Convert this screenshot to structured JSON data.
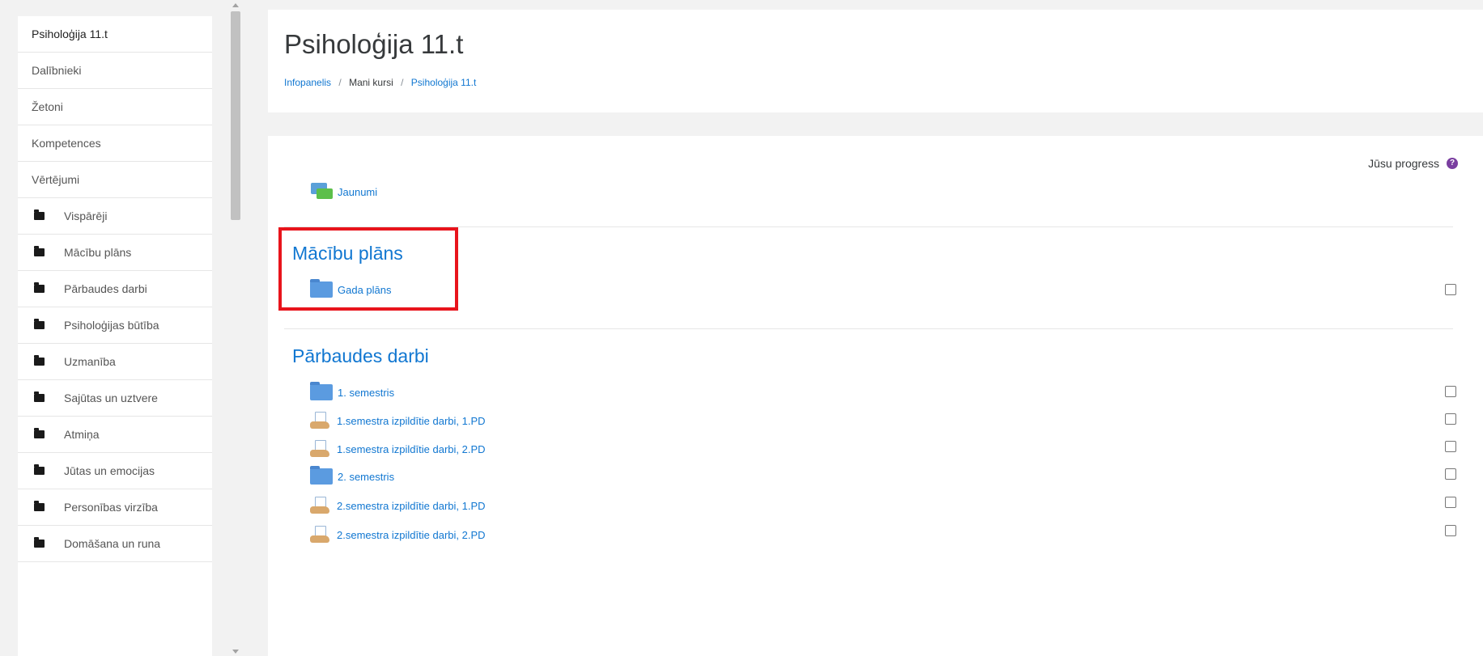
{
  "sidebar": {
    "course": "Psiholoģija 11.t",
    "nav": [
      "Dalībnieki",
      "Žetoni",
      "Kompetences",
      "Vērtējumi"
    ],
    "sections": [
      "Vispārēji",
      "Mācību plāns",
      "Pārbaudes darbi",
      "Psiholoģijas būtība",
      "Uzmanība",
      "Sajūtas un uztvere",
      "Atmiņa",
      "Jūtas un emocijas",
      "Personības virzība",
      "Domāšana un runa"
    ]
  },
  "header": {
    "title": "Psiholoģija 11.t",
    "breadcrumb": [
      "Infopanelis",
      "Mani kursi",
      "Psiholoģija 11.t"
    ]
  },
  "content": {
    "progress_label": "Jūsu progress",
    "help_icon": "?",
    "news": "Jaunumi",
    "sections": [
      {
        "title": "Mācību plāns",
        "activities": [
          "Gada plāns"
        ]
      },
      {
        "title": "Pārbaudes darbi",
        "activities": [
          "1. semestris",
          "1.semestra izpildītie darbi, 1.PD",
          "1.semestra izpildītie darbi, 2.PD",
          "2. semestris",
          "2.semestra izpildītie darbi, 1.PD",
          "2.semestra izpildītie darbi, 2.PD"
        ]
      }
    ]
  },
  "colors": {
    "link": "#1177d1",
    "highlight": "#e8141c",
    "help": "#7a3ea0",
    "background": "#f2f2f2"
  }
}
